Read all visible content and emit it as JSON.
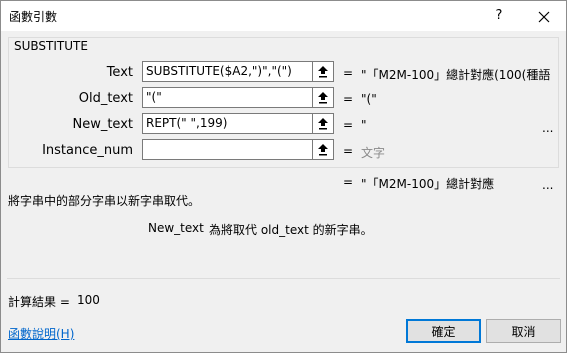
{
  "window": {
    "title": "函數引數",
    "help_label": "?",
    "close_icon": "close-icon"
  },
  "function": {
    "name": "SUBSTITUTE"
  },
  "args": [
    {
      "label": "Text",
      "value": "SUBSTITUTE($A2,\")\",\"(\")",
      "eq": "=",
      "result": "\"「M2M-100」總計對應(100(種語...",
      "result_muted": false,
      "ellipsis": ""
    },
    {
      "label": "Old_text",
      "value": "\"(\"",
      "eq": "=",
      "result": "\"(\"",
      "result_muted": false,
      "ellipsis": ""
    },
    {
      "label": "New_text",
      "value": "REPT(\" \",199)",
      "eq": "=",
      "result": "\"",
      "result_muted": false,
      "ellipsis": "..."
    },
    {
      "label": "Instance_num",
      "value": "",
      "eq": "=",
      "result": "文字",
      "result_muted": true,
      "ellipsis": ""
    }
  ],
  "formula_result": {
    "eq": "=",
    "value": "\"「M2M-100」總計對應",
    "ellipsis": "..."
  },
  "description": "將字串中的部分字串以新字串取代。",
  "arg_help": {
    "name": "New_text",
    "text": "為將取代 old_text 的新字串。"
  },
  "calc": {
    "label": "計算結果 =",
    "value": "100"
  },
  "help_link": "函數說明(H)",
  "buttons": {
    "ok": "確定",
    "cancel": "取消"
  }
}
